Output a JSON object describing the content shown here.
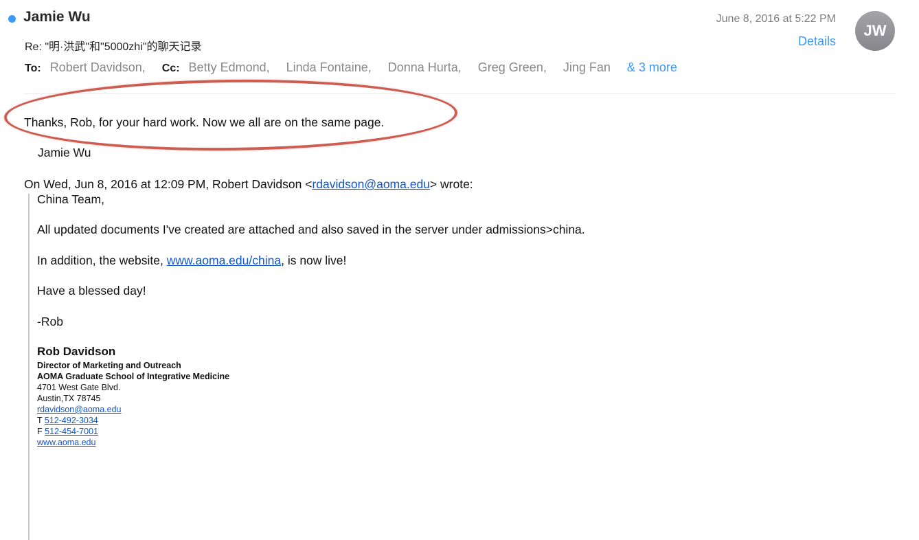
{
  "header": {
    "sender": "Jamie Wu",
    "subject": "Re: \"明·洪武\"和\"5000zhi\"的聊天记录",
    "date": "June 8, 2016 at 5:22 PM",
    "details_label": "Details",
    "avatar_initials": "JW",
    "unread_color": "#3b99fc"
  },
  "recipients": {
    "to_label": "To:",
    "to": [
      "Robert Davidson,"
    ],
    "cc_label": "Cc:",
    "cc": [
      "Betty Edmond,",
      "Linda Fontaine,",
      "Donna Hurta,",
      "Greg Green,",
      "Jing Fan"
    ],
    "more_label": "& 3 more"
  },
  "message": {
    "reply_text": "Thanks, Rob, for your hard work. Now we all are on the same page.",
    "signoff": "Jamie Wu",
    "highlight_color": "#cd5d50"
  },
  "quoted": {
    "attribution_prefix": "On Wed, Jun 8, 2016 at 12:09 PM, Robert Davidson <",
    "attribution_email": "rdavidson@aoma.edu",
    "attribution_suffix": "> wrote:",
    "greeting": "China Team,",
    "para1": "All updated documents I've created are attached and also saved in the server under admissions>china.",
    "para2_prefix": "In addition, the website, ",
    "para2_link": "www.aoma.edu/china",
    "para2_suffix": ", is now live!",
    "para3": "Have a blessed day!",
    "para4": "-Rob"
  },
  "signature": {
    "name": "Rob Davidson",
    "title": "Director of Marketing and Outreach",
    "org": "AOMA Graduate School of Integrative Medicine",
    "address1": "4701 West Gate Blvd.",
    "address2": "Austin,TX 78745",
    "email": "rdavidson@aoma.edu",
    "phone_label": "T",
    "phone": "512-492-3034",
    "fax_label": "F",
    "fax": "512-454-7001",
    "website": "www.aoma.edu"
  }
}
